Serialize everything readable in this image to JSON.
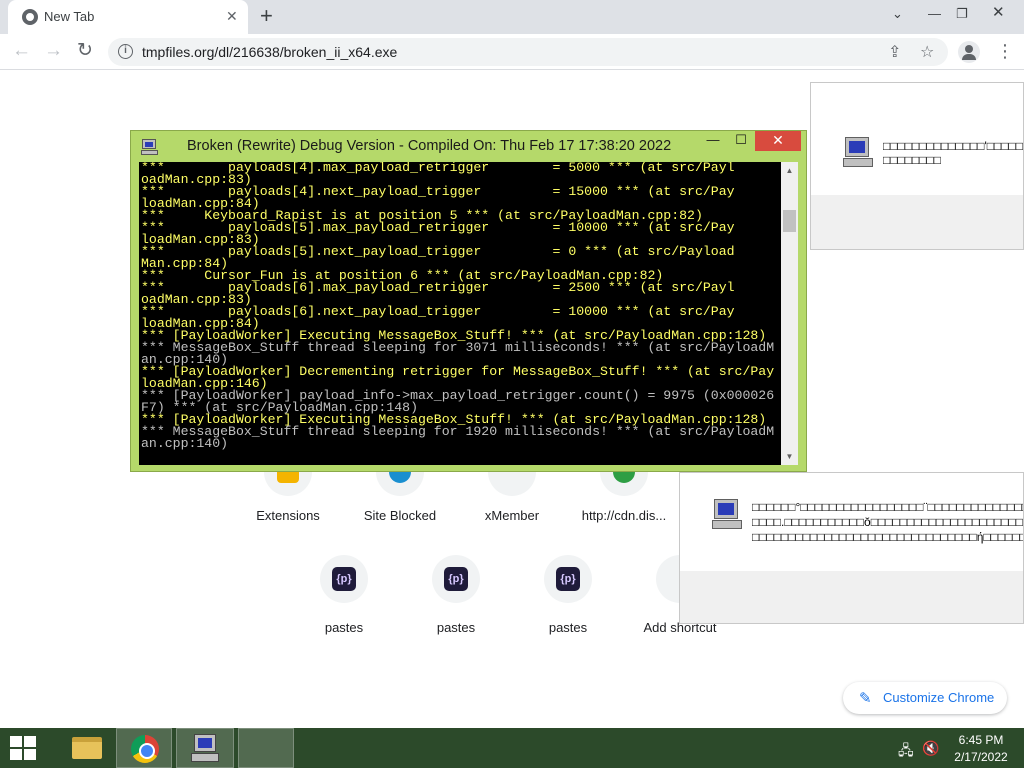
{
  "browser": {
    "tab_title": "New Tab",
    "url": "tmpfiles.org/dl/216638/broken_ii_x64.exe",
    "customize_label": "Customize Chrome"
  },
  "shortcuts": [
    {
      "label": "Extensions",
      "icon": "puzzle-icon"
    },
    {
      "label": "Site Blocked",
      "icon": "globe-icon"
    },
    {
      "label": "xMember",
      "icon": "site-icon"
    },
    {
      "label": "http://cdn.dis...",
      "icon": "site-icon"
    },
    {
      "label": "pastes",
      "icon": "p-icon",
      "glyph": "{p}"
    },
    {
      "label": "pastes",
      "icon": "p-icon",
      "glyph": "{p}"
    },
    {
      "label": "pastes",
      "icon": "p-icon",
      "glyph": "{p}"
    },
    {
      "label": "Add shortcut",
      "icon": "plus-icon"
    }
  ],
  "console": {
    "title": "Broken (Rewrite) Debug Version - Compiled On: Thu Feb 17 17:38:20 2022",
    "lines": [
      {
        "text": "***        payloads[4].max_payload_retrigger        = 5000 *** (at src/Payl",
        "style": "yellow"
      },
      {
        "text": "oadMan.cpp:83)",
        "style": "yellow"
      },
      {
        "text": "***        payloads[4].next_payload_trigger         = 15000 *** (at src/Pay",
        "style": "yellow"
      },
      {
        "text": "loadMan.cpp:84)",
        "style": "yellow"
      },
      {
        "text": "***     Keyboard_Rapist is at position 5 *** (at src/PayloadMan.cpp:82)",
        "style": "yellow"
      },
      {
        "text": "***        payloads[5].max_payload_retrigger        = 10000 *** (at src/Pay",
        "style": "yellow"
      },
      {
        "text": "loadMan.cpp:83)",
        "style": "yellow"
      },
      {
        "text": "***        payloads[5].next_payload_trigger         = 0 *** (at src/Payload",
        "style": "yellow"
      },
      {
        "text": "Man.cpp:84)",
        "style": "yellow"
      },
      {
        "text": "***     Cursor_Fun is at position 6 *** (at src/PayloadMan.cpp:82)",
        "style": "yellow"
      },
      {
        "text": "***        payloads[6].max_payload_retrigger        = 2500 *** (at src/Payl",
        "style": "yellow"
      },
      {
        "text": "oadMan.cpp:83)",
        "style": "yellow"
      },
      {
        "text": "***        payloads[6].next_payload_trigger         = 10000 *** (at src/Pay",
        "style": "yellow"
      },
      {
        "text": "loadMan.cpp:84)",
        "style": "yellow"
      },
      {
        "text": "*** [PayloadWorker] Executing MessageBox_Stuff! *** (at src/PayloadMan.cpp:128)",
        "style": "yellow"
      },
      {
        "text": "*** MessageBox_Stuff thread sleeping for 3071 milliseconds! *** (at src/PayloadM",
        "style": "grey"
      },
      {
        "text": "an.cpp:140)",
        "style": "grey"
      },
      {
        "text": "*** [PayloadWorker] Decrementing retrigger for MessageBox_Stuff! *** (at src/Pay",
        "style": "yellow"
      },
      {
        "text": "loadMan.cpp:146)",
        "style": "yellow"
      },
      {
        "text": "*** [PayloadWorker] payload_info->max_payload_retrigger.count() = 9975 (0x000026",
        "style": "grey"
      },
      {
        "text": "F7) *** (at src/PayloadMan.cpp:148)",
        "style": "grey"
      },
      {
        "text": "*** [PayloadWorker] Executing MessageBox_Stuff! *** (at src/PayloadMan.cpp:128)",
        "style": "yellow"
      },
      {
        "text": "*** MessageBox_Stuff thread sleeping for 1920 milliseconds! *** (at src/PayloadM",
        "style": "grey"
      },
      {
        "text": "an.cpp:140)",
        "style": "grey"
      }
    ]
  },
  "msgbox_top": {
    "line1": "□□□□□□□□□□□□□□'□□□□□",
    "line2": "□□□□□□□□"
  },
  "msgbox_bottom": {
    "line1": "□□□□□□°□□□□□□□□□□□□□□□□□¨□□□□□□□□□□□□□□□□",
    "line2": "□□□□.□□□□□□□□□□□ŏ□□□□□□□□□□□□□□□□□□□□□□□□",
    "line3": "□□□□□□□□□□□□□□□□□□□□□□□□□□□□□□□ή□□□□□□□□"
  },
  "taskbar": {
    "time": "6:45 PM",
    "date": "2/17/2022"
  },
  "colors": {
    "console_frame": "#b5d96a",
    "console_text": "#ffff66",
    "taskbar": "#2c4a2a",
    "accent": "#1a73e8"
  }
}
